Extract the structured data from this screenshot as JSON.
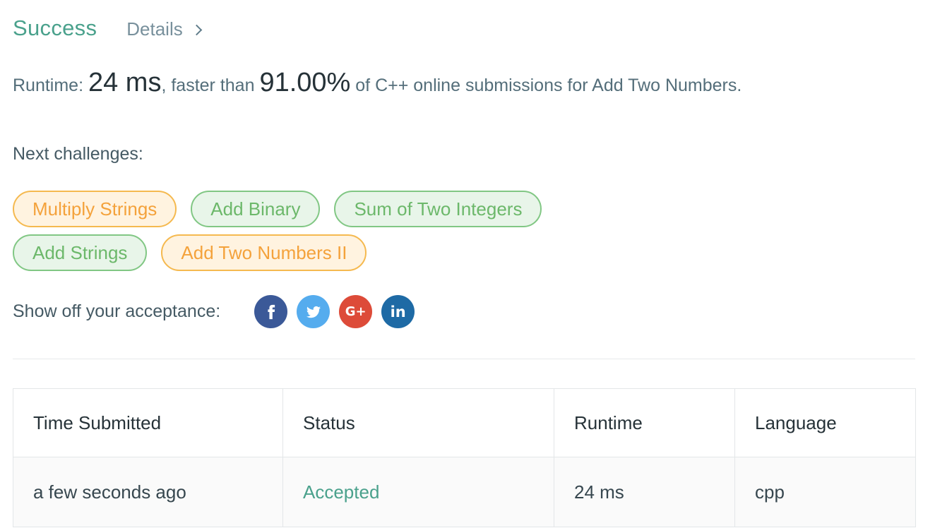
{
  "header": {
    "status": "Success",
    "details_label": "Details"
  },
  "runtime": {
    "prefix": "Runtime: ",
    "value": "24 ms",
    "middle": ", faster than ",
    "percent": "91.00%",
    "suffix": " of C++ online submissions for Add Two Numbers."
  },
  "next": {
    "label": "Next challenges:",
    "rows": [
      [
        {
          "label": "Multiply Strings",
          "difficulty": "medium"
        },
        {
          "label": "Add Binary",
          "difficulty": "easy"
        },
        {
          "label": "Sum of Two Integers",
          "difficulty": "easy"
        }
      ],
      [
        {
          "label": "Add Strings",
          "difficulty": "easy"
        },
        {
          "label": "Add Two Numbers II",
          "difficulty": "medium"
        }
      ]
    ]
  },
  "share": {
    "label": "Show off your acceptance:",
    "icons": [
      {
        "name": "facebook-icon",
        "glyph": "f"
      },
      {
        "name": "twitter-icon",
        "glyph": "🐦"
      },
      {
        "name": "google-plus-icon",
        "glyph": "G+"
      },
      {
        "name": "linkedin-icon",
        "glyph": "in"
      }
    ]
  },
  "table": {
    "headers": [
      "Time Submitted",
      "Status",
      "Runtime",
      "Language"
    ],
    "rows": [
      [
        "a few seconds ago",
        "Accepted",
        "24 ms",
        "cpp"
      ]
    ]
  },
  "colors": {
    "success": "#4aa18c",
    "medium": "#f4a23b",
    "easy": "#6cb86a",
    "facebook": "#3b5998",
    "twitter": "#55acee",
    "google_plus": "#dd4b39",
    "linkedin": "#1e6aa5"
  }
}
